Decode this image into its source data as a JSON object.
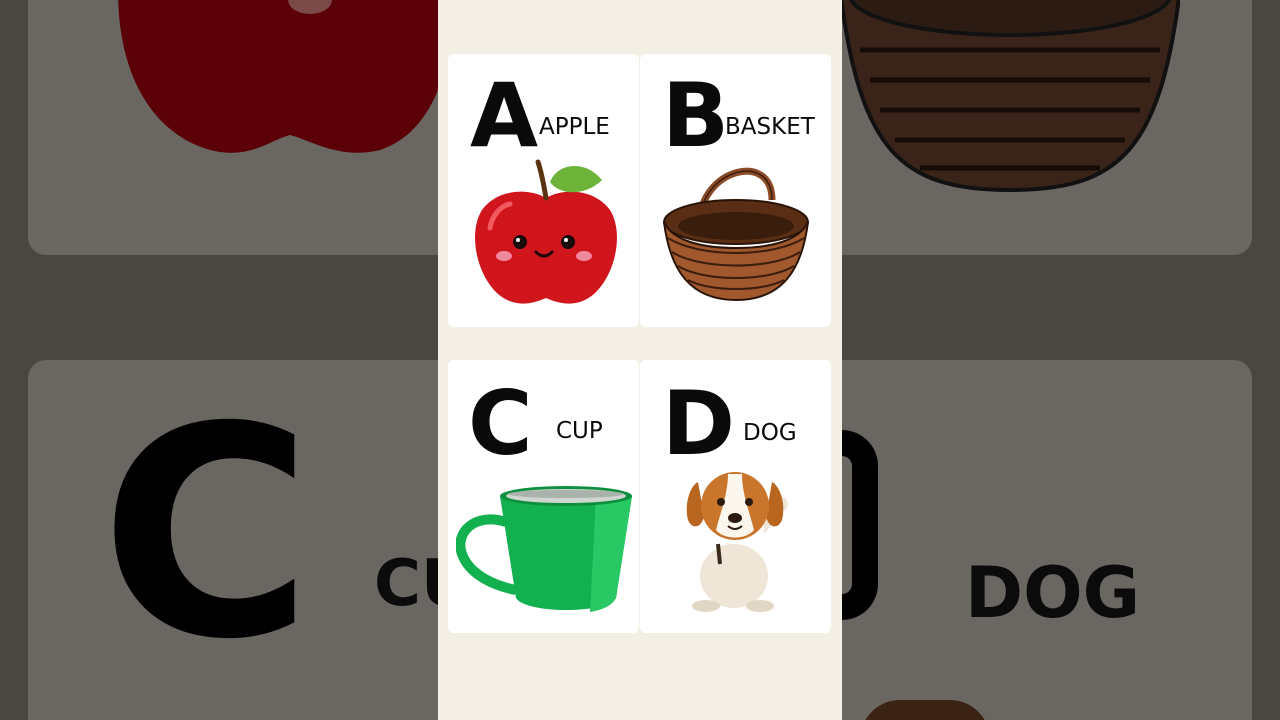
{
  "cards": [
    {
      "letter": "A",
      "word": "APPLE",
      "picture": "apple-illustration"
    },
    {
      "letter": "B",
      "word": "BASKET",
      "picture": "basket-illustration"
    },
    {
      "letter": "C",
      "word": "CUP",
      "picture": "cup-illustration"
    },
    {
      "letter": "D",
      "word": "DOG",
      "picture": "dog-illustration"
    }
  ],
  "background": {
    "letter_c": "C",
    "word_cup": "CU",
    "word_dog": "DOG"
  },
  "colors": {
    "stage": "#f4efe4",
    "card": "#ffffff",
    "apple": "#d0161c",
    "leaf": "#6fb43a",
    "cup": "#12b04f",
    "basket": "#8a4a26",
    "dog_brown": "#b8661f"
  }
}
